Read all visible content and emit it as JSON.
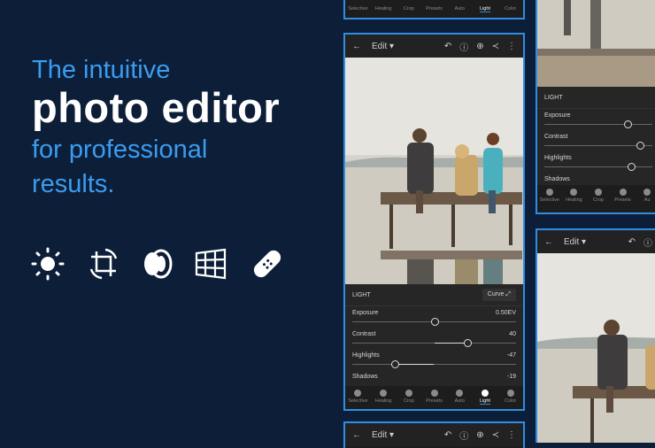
{
  "hero": {
    "line1": "The intuitive",
    "line2": "photo editor",
    "line3": "for professional",
    "line4": "results."
  },
  "feature_icons": [
    "sun-icon",
    "crop-rotate-icon",
    "lens-icon",
    "perspective-grid-icon",
    "bandage-icon"
  ],
  "editor": {
    "edit_label": "Edit",
    "panel_title": "LIGHT",
    "curve_label": "Curve",
    "sliders": [
      {
        "label": "Exposure",
        "value": "0.50EV",
        "level": 0.5
      },
      {
        "label": "Contrast",
        "value": "40",
        "level": 0.7
      },
      {
        "label": "Highlights",
        "value": "-47",
        "level": 0.26
      },
      {
        "label": "Shadows",
        "value": "-19",
        "level": 0.4
      }
    ],
    "tools": [
      "Selective",
      "Healing",
      "Crop",
      "Presets",
      "Auto",
      "Light",
      "Color"
    ],
    "active_tool": "Light",
    "right_tools": [
      "Selective",
      "Healing",
      "Crop",
      "Presets",
      "Au"
    ]
  },
  "colors": {
    "background": "#0d1e38",
    "accent": "#3a9cf0",
    "frame": "#2e8ee6"
  }
}
